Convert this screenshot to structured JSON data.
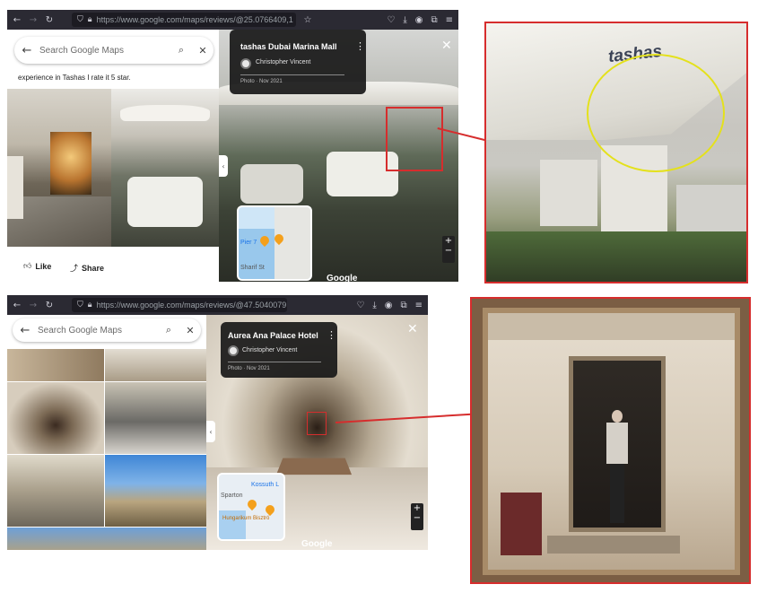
{
  "top": {
    "url": "https://www.google.com/maps/reviews/@25.0766409,1",
    "search_placeholder": "Search Google Maps",
    "review_text": "experience in Tashas I rate it 5 star.",
    "like_label": "Like",
    "share_label": "Share",
    "place_title": "tashas Dubai Marina Mall",
    "author": "Christopher Vincent",
    "photo_date": "Photo · Nov 2021",
    "minimap_label": "Pier 7",
    "minimap_street": "Sharif St",
    "google_logo": "Google",
    "zoom_plus": "+",
    "zoom_minus": "−",
    "zoom_image_brand": "tashas"
  },
  "bottom": {
    "url": "https://www.google.com/maps/reviews/@47.5040079,1",
    "search_placeholder": "Search Google Maps",
    "place_title": "Aurea Ana Palace Hotel",
    "author": "Christopher Vincent",
    "photo_date": "Photo · Nov 2021",
    "minimap_label_1": "Kossuth L",
    "minimap_label_2": "Sparton",
    "minimap_label_3": "Hungarikum Bisztró",
    "google_logo": "Google",
    "zoom_plus": "+",
    "zoom_minus": "−"
  },
  "colors": {
    "highlight_red": "#d62d2d",
    "highlight_yellow": "#e4e11c",
    "browser_chrome": "#2b2a33"
  }
}
